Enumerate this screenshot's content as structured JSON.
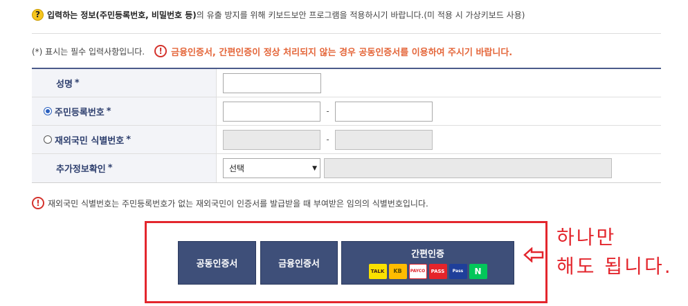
{
  "notice": {
    "icon": "question-icon",
    "text_bold": "입력하는 정보(주민등록번호, 비밀번호 등)",
    "text_rest": "의 유출 방지를 위해 키보드보안 프로그램을 적용하시기 바랍니다.(미 적용 시 가상키보드 사용)"
  },
  "required": {
    "text": "(*) 표시는 필수 입력사항입니다.",
    "warning": "금융인증서, 간편인증이 정상 처리되지 않는 경우 공동인증서를 이용하여 주시기 바랍니다."
  },
  "form": {
    "name_label": "성명",
    "rrn_label": "주민등록번호",
    "foreign_label": "재외국민 식별번호",
    "extra_label": "추가정보확인",
    "star": "*",
    "dash": "-",
    "select_value": "선택",
    "rrn_selected": true
  },
  "footnote": "재외국민 식별번호는 주민등록번호가 없는 재외국민이 인증서를 발급받을 때 부여받은 임의의 식별번호입니다.",
  "buttons": {
    "joint_cert": "공동인증서",
    "financial_cert": "금융인증서",
    "simple_auth": "간편인증",
    "logos": {
      "kakao": "TALK",
      "kb": "KB",
      "payco": "PAYCO",
      "pass": "PASS",
      "samsung_pass": "Pass",
      "naver": "N"
    }
  },
  "annotation": {
    "line1": "하나만",
    "line2": "해도 됩니다."
  },
  "colors": {
    "accent_red": "#e3262d",
    "button_navy": "#3e4f79",
    "label_navy": "#2e3f6e",
    "warning_orange": "#e4663a"
  }
}
